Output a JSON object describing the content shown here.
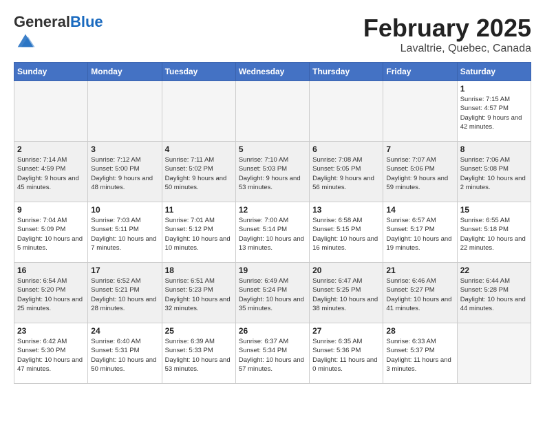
{
  "header": {
    "logo_general": "General",
    "logo_blue": "Blue",
    "month_title": "February 2025",
    "subtitle": "Lavaltrie, Quebec, Canada"
  },
  "days_of_week": [
    "Sunday",
    "Monday",
    "Tuesday",
    "Wednesday",
    "Thursday",
    "Friday",
    "Saturday"
  ],
  "weeks": [
    [
      {
        "day": "",
        "info": "",
        "empty": true
      },
      {
        "day": "",
        "info": "",
        "empty": true
      },
      {
        "day": "",
        "info": "",
        "empty": true
      },
      {
        "day": "",
        "info": "",
        "empty": true
      },
      {
        "day": "",
        "info": "",
        "empty": true
      },
      {
        "day": "",
        "info": "",
        "empty": true
      },
      {
        "day": "1",
        "info": "Sunrise: 7:15 AM\nSunset: 4:57 PM\nDaylight: 9 hours and 42 minutes.",
        "empty": false
      }
    ],
    [
      {
        "day": "2",
        "info": "Sunrise: 7:14 AM\nSunset: 4:59 PM\nDaylight: 9 hours and 45 minutes.",
        "empty": false
      },
      {
        "day": "3",
        "info": "Sunrise: 7:12 AM\nSunset: 5:00 PM\nDaylight: 9 hours and 48 minutes.",
        "empty": false
      },
      {
        "day": "4",
        "info": "Sunrise: 7:11 AM\nSunset: 5:02 PM\nDaylight: 9 hours and 50 minutes.",
        "empty": false
      },
      {
        "day": "5",
        "info": "Sunrise: 7:10 AM\nSunset: 5:03 PM\nDaylight: 9 hours and 53 minutes.",
        "empty": false
      },
      {
        "day": "6",
        "info": "Sunrise: 7:08 AM\nSunset: 5:05 PM\nDaylight: 9 hours and 56 minutes.",
        "empty": false
      },
      {
        "day": "7",
        "info": "Sunrise: 7:07 AM\nSunset: 5:06 PM\nDaylight: 9 hours and 59 minutes.",
        "empty": false
      },
      {
        "day": "8",
        "info": "Sunrise: 7:06 AM\nSunset: 5:08 PM\nDaylight: 10 hours and 2 minutes.",
        "empty": false
      }
    ],
    [
      {
        "day": "9",
        "info": "Sunrise: 7:04 AM\nSunset: 5:09 PM\nDaylight: 10 hours and 5 minutes.",
        "empty": false
      },
      {
        "day": "10",
        "info": "Sunrise: 7:03 AM\nSunset: 5:11 PM\nDaylight: 10 hours and 7 minutes.",
        "empty": false
      },
      {
        "day": "11",
        "info": "Sunrise: 7:01 AM\nSunset: 5:12 PM\nDaylight: 10 hours and 10 minutes.",
        "empty": false
      },
      {
        "day": "12",
        "info": "Sunrise: 7:00 AM\nSunset: 5:14 PM\nDaylight: 10 hours and 13 minutes.",
        "empty": false
      },
      {
        "day": "13",
        "info": "Sunrise: 6:58 AM\nSunset: 5:15 PM\nDaylight: 10 hours and 16 minutes.",
        "empty": false
      },
      {
        "day": "14",
        "info": "Sunrise: 6:57 AM\nSunset: 5:17 PM\nDaylight: 10 hours and 19 minutes.",
        "empty": false
      },
      {
        "day": "15",
        "info": "Sunrise: 6:55 AM\nSunset: 5:18 PM\nDaylight: 10 hours and 22 minutes.",
        "empty": false
      }
    ],
    [
      {
        "day": "16",
        "info": "Sunrise: 6:54 AM\nSunset: 5:20 PM\nDaylight: 10 hours and 25 minutes.",
        "empty": false
      },
      {
        "day": "17",
        "info": "Sunrise: 6:52 AM\nSunset: 5:21 PM\nDaylight: 10 hours and 28 minutes.",
        "empty": false
      },
      {
        "day": "18",
        "info": "Sunrise: 6:51 AM\nSunset: 5:23 PM\nDaylight: 10 hours and 32 minutes.",
        "empty": false
      },
      {
        "day": "19",
        "info": "Sunrise: 6:49 AM\nSunset: 5:24 PM\nDaylight: 10 hours and 35 minutes.",
        "empty": false
      },
      {
        "day": "20",
        "info": "Sunrise: 6:47 AM\nSunset: 5:25 PM\nDaylight: 10 hours and 38 minutes.",
        "empty": false
      },
      {
        "day": "21",
        "info": "Sunrise: 6:46 AM\nSunset: 5:27 PM\nDaylight: 10 hours and 41 minutes.",
        "empty": false
      },
      {
        "day": "22",
        "info": "Sunrise: 6:44 AM\nSunset: 5:28 PM\nDaylight: 10 hours and 44 minutes.",
        "empty": false
      }
    ],
    [
      {
        "day": "23",
        "info": "Sunrise: 6:42 AM\nSunset: 5:30 PM\nDaylight: 10 hours and 47 minutes.",
        "empty": false
      },
      {
        "day": "24",
        "info": "Sunrise: 6:40 AM\nSunset: 5:31 PM\nDaylight: 10 hours and 50 minutes.",
        "empty": false
      },
      {
        "day": "25",
        "info": "Sunrise: 6:39 AM\nSunset: 5:33 PM\nDaylight: 10 hours and 53 minutes.",
        "empty": false
      },
      {
        "day": "26",
        "info": "Sunrise: 6:37 AM\nSunset: 5:34 PM\nDaylight: 10 hours and 57 minutes.",
        "empty": false
      },
      {
        "day": "27",
        "info": "Sunrise: 6:35 AM\nSunset: 5:36 PM\nDaylight: 11 hours and 0 minutes.",
        "empty": false
      },
      {
        "day": "28",
        "info": "Sunrise: 6:33 AM\nSunset: 5:37 PM\nDaylight: 11 hours and 3 minutes.",
        "empty": false
      },
      {
        "day": "",
        "info": "",
        "empty": true
      }
    ]
  ]
}
